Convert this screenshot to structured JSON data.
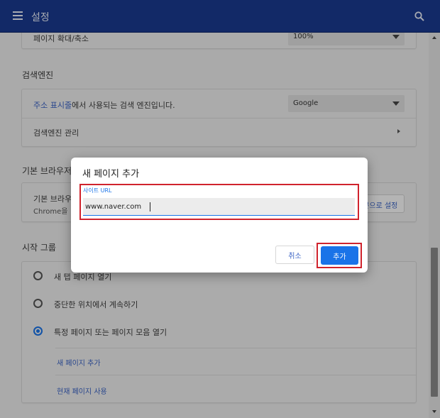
{
  "header": {
    "title": "설정"
  },
  "zoom": {
    "label": "페이지 확대/축소",
    "value": "100%"
  },
  "search_engine": {
    "section_title": "검색엔진",
    "address_bar_link": "주소 표시줄",
    "address_bar_suffix": "에서 사용되는 검색 엔진입니다.",
    "engine_value": "Google",
    "manage_label": "검색엔진 관리"
  },
  "default_browser": {
    "section_title": "기본 브라우저",
    "label": "기본 브라우저",
    "sublabel": "Chrome을",
    "button_label": "기본으로 설정"
  },
  "startup": {
    "section_title": "시작 그룹",
    "options": [
      {
        "label": "새 탭 페이지 열기",
        "checked": false
      },
      {
        "label": "중단한 위치에서 계속하기",
        "checked": false
      },
      {
        "label": "특정 페이지 또는 페이지 모음 열기",
        "checked": true
      }
    ],
    "add_page_link": "새 페이지 추가",
    "use_current_link": "현재 페이지 사용"
  },
  "dialog": {
    "title": "새 페이지 추가",
    "field_label": "사이트 URL",
    "field_value": "www.naver.com",
    "cancel_label": "취소",
    "add_label": "추가"
  },
  "colors": {
    "header": "#1a3a8f",
    "accent": "#1a73e8",
    "highlight": "#d0232d"
  }
}
